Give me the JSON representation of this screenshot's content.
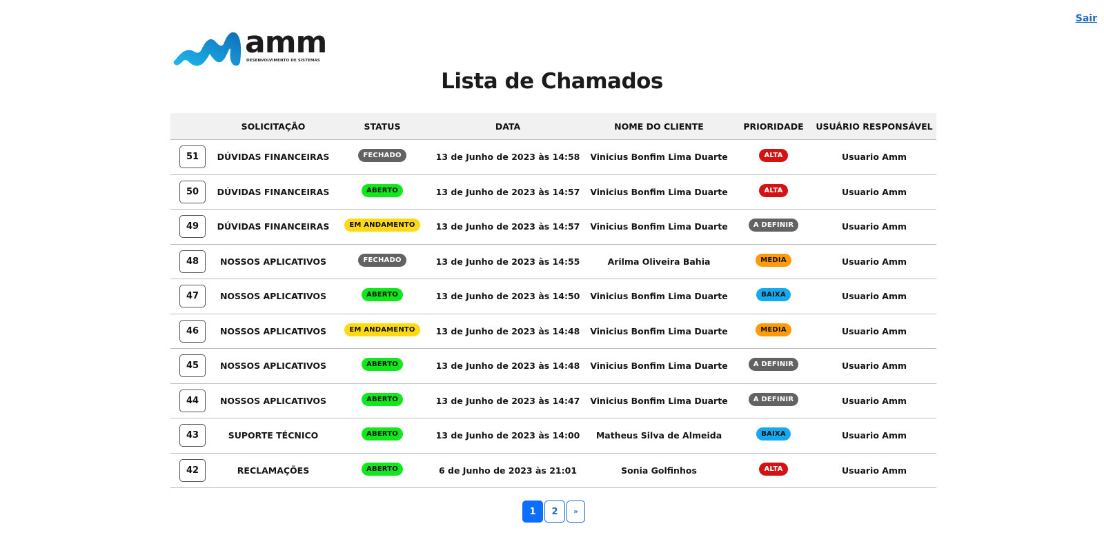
{
  "header": {
    "logout_label": "Sair"
  },
  "logo": {
    "word": "amm",
    "subtitle": "DESENVOLVIMENTO DE SISTEMAS"
  },
  "page": {
    "title": "Lista de Chamados"
  },
  "colors": {
    "accent": "#0d6efd",
    "link": "#1a6dcc",
    "status_fechado": "#626262",
    "status_aberto": "#11e81b",
    "status_andamento": "#ffd912",
    "prio_alta": "#d31313",
    "prio_definir": "#626262",
    "prio_media": "#ff9a0a",
    "prio_baixa": "#14aaf0"
  },
  "table": {
    "columns": [
      "",
      "SOLICITAÇÃO",
      "STATUS",
      "DATA",
      "NOME DO CLIENTE",
      "PRIORIDADE",
      "USUÁRIO RESPONSÁVEL"
    ],
    "rows": [
      {
        "id": "51",
        "solicitacao": "DÚVIDAS FINANCEIRAS",
        "status": "FECHADO",
        "data": "13 de Junho de 2023 às 14:58",
        "cliente": "Vinicius Bonfim Lima Duarte",
        "prioridade": "ALTA",
        "usuario": "Usuario Amm"
      },
      {
        "id": "50",
        "solicitacao": "DÚVIDAS FINANCEIRAS",
        "status": "ABERTO",
        "data": "13 de Junho de 2023 às 14:57",
        "cliente": "Vinicius Bonfim Lima Duarte",
        "prioridade": "ALTA",
        "usuario": "Usuario Amm"
      },
      {
        "id": "49",
        "solicitacao": "DÚVIDAS FINANCEIRAS",
        "status": "EM ANDAMENTO",
        "data": "13 de Junho de 2023 às 14:57",
        "cliente": "Vinicius Bonfim Lima Duarte",
        "prioridade": "A DEFINIR",
        "usuario": "Usuario Amm"
      },
      {
        "id": "48",
        "solicitacao": "NOSSOS APLICATIVOS",
        "status": "FECHADO",
        "data": "13 de Junho de 2023 às 14:55",
        "cliente": "Arilma Oliveira Bahia",
        "prioridade": "MEDIA",
        "usuario": "Usuario Amm"
      },
      {
        "id": "47",
        "solicitacao": "NOSSOS APLICATIVOS",
        "status": "ABERTO",
        "data": "13 de Junho de 2023 às 14:50",
        "cliente": "Vinicius Bonfim Lima Duarte",
        "prioridade": "BAIXA",
        "usuario": "Usuario Amm"
      },
      {
        "id": "46",
        "solicitacao": "NOSSOS APLICATIVOS",
        "status": "EM ANDAMENTO",
        "data": "13 de Junho de 2023 às 14:48",
        "cliente": "Vinicius Bonfim Lima Duarte",
        "prioridade": "MEDIA",
        "usuario": "Usuario Amm"
      },
      {
        "id": "45",
        "solicitacao": "NOSSOS APLICATIVOS",
        "status": "ABERTO",
        "data": "13 de Junho de 2023 às 14:48",
        "cliente": "Vinicius Bonfim Lima Duarte",
        "prioridade": "A DEFINIR",
        "usuario": "Usuario Amm"
      },
      {
        "id": "44",
        "solicitacao": "NOSSOS APLICATIVOS",
        "status": "ABERTO",
        "data": "13 de Junho de 2023 às 14:47",
        "cliente": "Vinicius Bonfim Lima Duarte",
        "prioridade": "A DEFINIR",
        "usuario": "Usuario Amm"
      },
      {
        "id": "43",
        "solicitacao": "SUPORTE TÉCNICO",
        "status": "ABERTO",
        "data": "13 de Junho de 2023 às 14:00",
        "cliente": "Matheus Silva de Almeida",
        "prioridade": "BAIXA",
        "usuario": "Usuario Amm"
      },
      {
        "id": "42",
        "solicitacao": "RECLAMAÇÕES",
        "status": "ABERTO",
        "data": "6 de Junho de 2023 às 21:01",
        "cliente": "Sonia Golfinhos",
        "prioridade": "ALTA",
        "usuario": "Usuario Amm"
      }
    ]
  },
  "pagination": {
    "pages": [
      "1",
      "2"
    ],
    "current": "1",
    "next_label": "»"
  }
}
